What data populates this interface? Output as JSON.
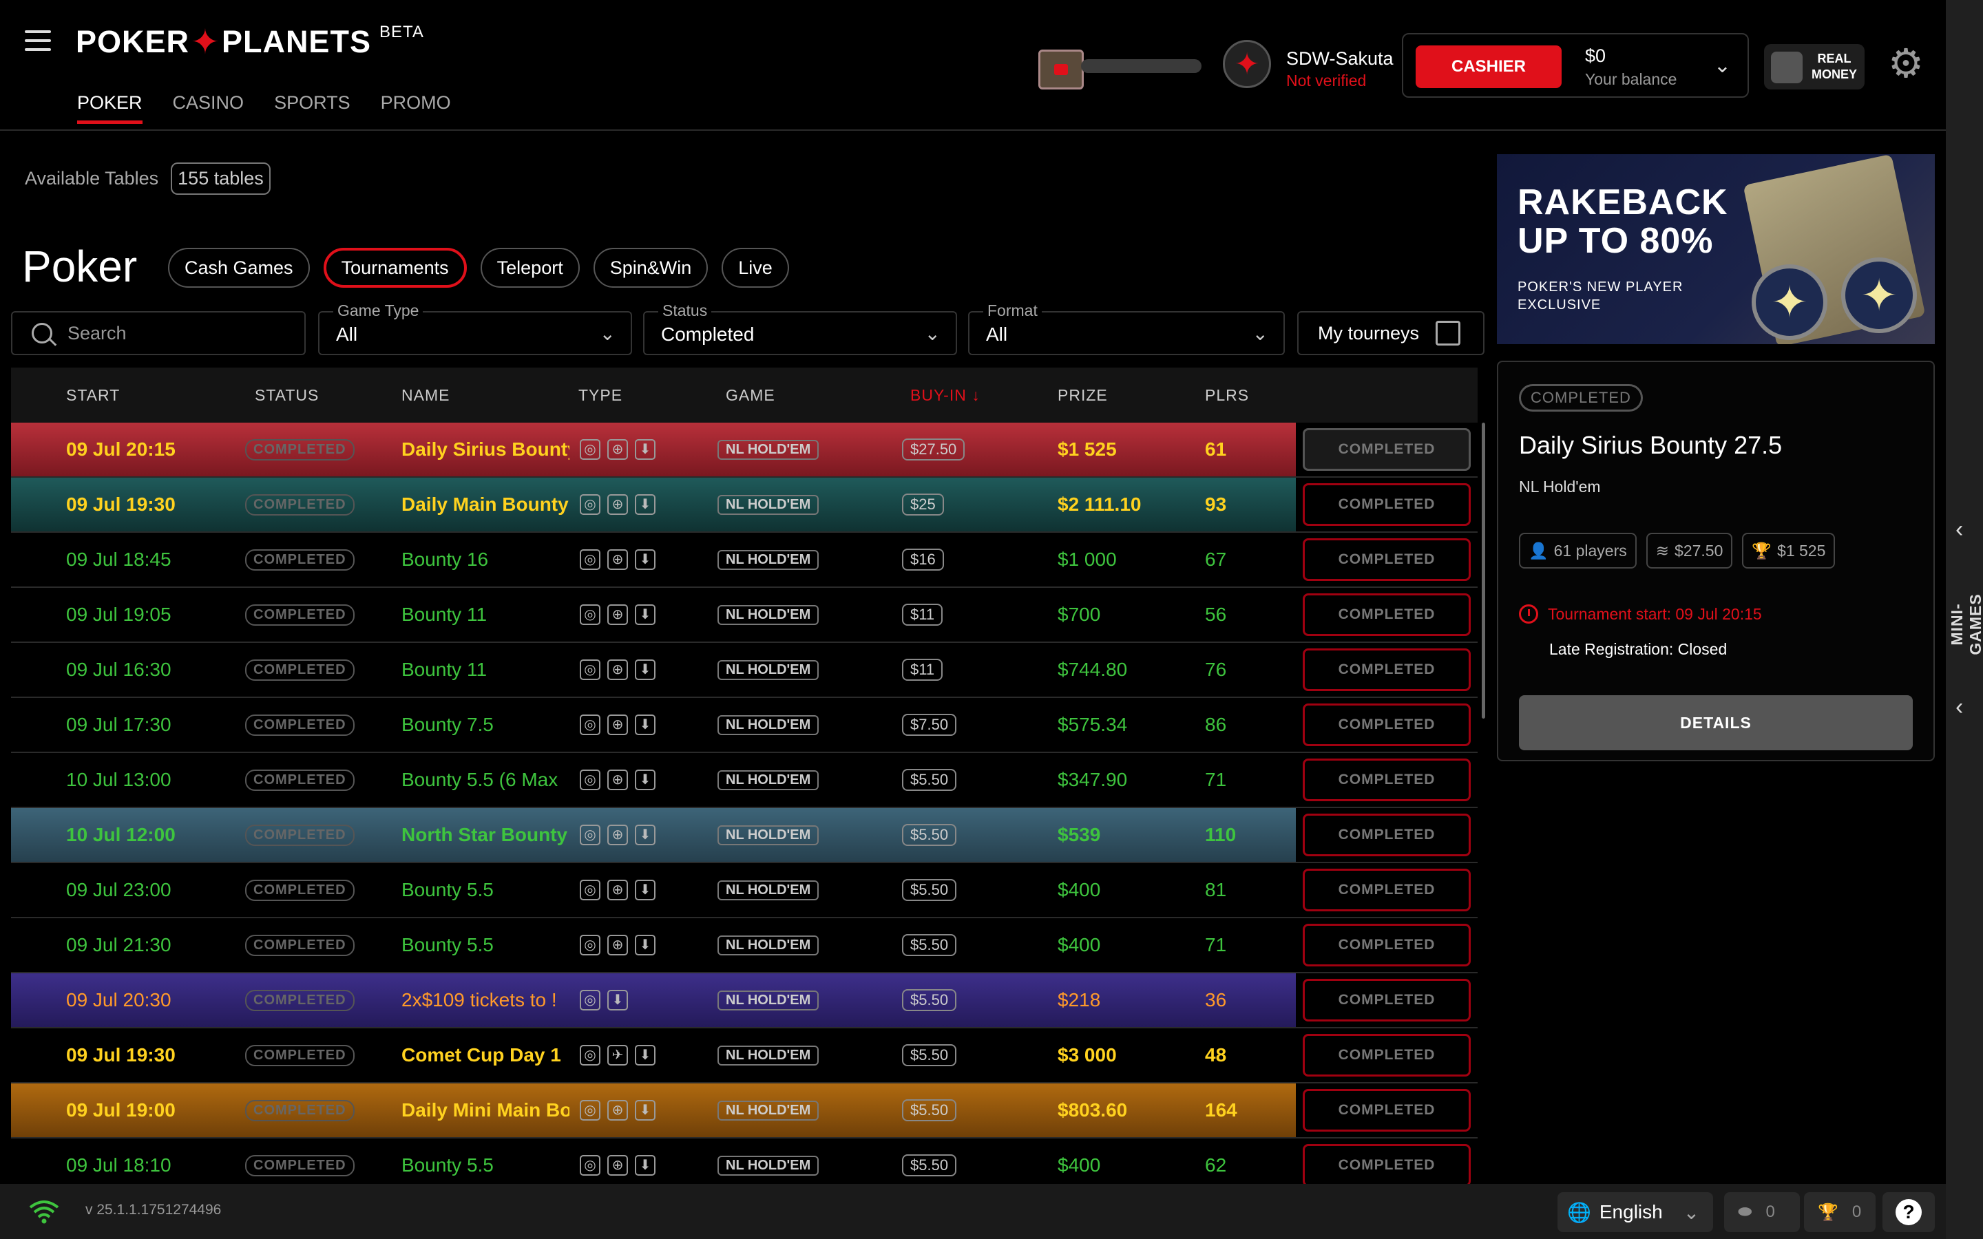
{
  "brand": {
    "name_left": "POKER",
    "name_right": "PLANETS",
    "beta": "BETA"
  },
  "nav": [
    "POKER",
    "CASINO",
    "SPORTS",
    "PROMO"
  ],
  "user": {
    "name": "SDW-Sakuta",
    "status": "Not verified"
  },
  "wallet": {
    "cashier": "CASHIER",
    "balance": "$0",
    "balance_label": "Your balance"
  },
  "real_money": {
    "line1": "REAL",
    "line2": "MONEY"
  },
  "available": {
    "label": "Available Tables",
    "count": "155 tables"
  },
  "page_title": "Poker",
  "tabs": [
    "Cash Games",
    "Tournaments",
    "Teleport",
    "Spin&Win",
    "Live"
  ],
  "search": {
    "placeholder": "Search"
  },
  "filters": {
    "game_type": {
      "label": "Game Type",
      "value": "All"
    },
    "status": {
      "label": "Status",
      "value": "Completed"
    },
    "format": {
      "label": "Format",
      "value": "All"
    },
    "my_tourneys": "My tourneys"
  },
  "table": {
    "headers": {
      "start": "START",
      "status": "STATUS",
      "name": "NAME",
      "type": "TYPE",
      "game": "GAME",
      "buyin": "BUY-IN ↓",
      "prize": "PRIZE",
      "plrs": "PLRS"
    },
    "rows": [
      {
        "start": "09 Jul 20:15",
        "status": "COMPLETED",
        "name": "Daily Sirius Bounty",
        "game": "NL HOLD'EM",
        "buyin": "$27.50",
        "prize": "$1 525",
        "plrs": "61",
        "action": "COMPLETED"
      },
      {
        "start": "09 Jul 19:30",
        "status": "COMPLETED",
        "name": "Daily Main Bounty",
        "game": "NL HOLD'EM",
        "buyin": "$25",
        "prize": "$2 111.10",
        "plrs": "93",
        "action": "COMPLETED"
      },
      {
        "start": "09 Jul 18:45",
        "status": "COMPLETED",
        "name": "Bounty 16",
        "game": "NL HOLD'EM",
        "buyin": "$16",
        "prize": "$1 000",
        "plrs": "67",
        "action": "COMPLETED"
      },
      {
        "start": "09 Jul 19:05",
        "status": "COMPLETED",
        "name": "Bounty 11",
        "game": "NL HOLD'EM",
        "buyin": "$11",
        "prize": "$700",
        "plrs": "56",
        "action": "COMPLETED"
      },
      {
        "start": "09 Jul 16:30",
        "status": "COMPLETED",
        "name": "Bounty 11",
        "game": "NL HOLD'EM",
        "buyin": "$11",
        "prize": "$744.80",
        "plrs": "76",
        "action": "COMPLETED"
      },
      {
        "start": "09 Jul 17:30",
        "status": "COMPLETED",
        "name": "Bounty 7.5",
        "game": "NL HOLD'EM",
        "buyin": "$7.50",
        "prize": "$575.34",
        "plrs": "86",
        "action": "COMPLETED"
      },
      {
        "start": "10 Jul 13:00",
        "status": "COMPLETED",
        "name": "Bounty 5.5 (6 Max",
        "game": "NL HOLD'EM",
        "buyin": "$5.50",
        "prize": "$347.90",
        "plrs": "71",
        "action": "COMPLETED"
      },
      {
        "start": "10 Jul 12:00",
        "status": "COMPLETED",
        "name": "North Star Bounty",
        "game": "NL HOLD'EM",
        "buyin": "$5.50",
        "prize": "$539",
        "plrs": "110",
        "action": "COMPLETED"
      },
      {
        "start": "09 Jul 23:00",
        "status": "COMPLETED",
        "name": "Bounty 5.5",
        "game": "NL HOLD'EM",
        "buyin": "$5.50",
        "prize": "$400",
        "plrs": "81",
        "action": "COMPLETED"
      },
      {
        "start": "09 Jul 21:30",
        "status": "COMPLETED",
        "name": "Bounty 5.5",
        "game": "NL HOLD'EM",
        "buyin": "$5.50",
        "prize": "$400",
        "plrs": "71",
        "action": "COMPLETED"
      },
      {
        "start": "09 Jul 20:30",
        "status": "COMPLETED",
        "name": "2x$109 tickets to !",
        "game": "NL HOLD'EM",
        "buyin": "$5.50",
        "prize": "$218",
        "plrs": "36",
        "action": "COMPLETED"
      },
      {
        "start": "09 Jul 19:30",
        "status": "COMPLETED",
        "name": "Comet Cup Day 1",
        "game": "NL HOLD'EM",
        "buyin": "$5.50",
        "prize": "$3 000",
        "plrs": "48",
        "action": "COMPLETED"
      },
      {
        "start": "09 Jul 19:00",
        "status": "COMPLETED",
        "name": "Daily Mini Main Bo",
        "game": "NL HOLD'EM",
        "buyin": "$5.50",
        "prize": "$803.60",
        "plrs": "164",
        "action": "COMPLETED"
      },
      {
        "start": "09 Jul 18:10",
        "status": "COMPLETED",
        "name": "Bounty 5.5",
        "game": "NL HOLD'EM",
        "buyin": "$5.50",
        "prize": "$400",
        "plrs": "62",
        "action": "COMPLETED"
      }
    ]
  },
  "banner": {
    "line1": "RAKEBACK",
    "line2": "UP TO 80%",
    "sub1": "POKER'S NEW PLAYER",
    "sub2": "EXCLUSIVE"
  },
  "detail": {
    "badge": "COMPLETED",
    "title": "Daily Sirius Bounty 27.5",
    "game": "NL Hold'em",
    "players": "61 players",
    "buyin": "$27.50",
    "prize": "$1 525",
    "start": "Tournament start: 09 Jul 20:15",
    "late": "Late Registration: Closed",
    "button": "DETAILS"
  },
  "mini_games": "MINI-GAMES",
  "footer": {
    "version": "v 25.1.1.1751274496",
    "language": "English",
    "tickets_count": "0",
    "trophies_count": "0"
  },
  "colors": {
    "accent": "#e0101a",
    "green": "#3ec43e",
    "gold": "#ffd21f",
    "orange": "#ff9a2a"
  },
  "progress": {
    "level": 0.0
  }
}
